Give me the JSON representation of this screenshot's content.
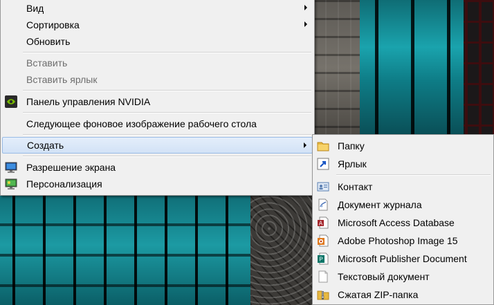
{
  "main_menu": {
    "items": [
      {
        "label": "Вид",
        "submenu": true,
        "enabled": true
      },
      {
        "label": "Сортировка",
        "submenu": true,
        "enabled": true
      },
      {
        "label": "Обновить",
        "enabled": true
      },
      {
        "label": "Вставить",
        "enabled": false
      },
      {
        "label": "Вставить ярлык",
        "enabled": false
      },
      {
        "label": "Панель управления NVIDIA",
        "icon": "nvidia-icon",
        "enabled": true
      },
      {
        "label": "Следующее фоновое изображение рабочего стола",
        "enabled": true
      },
      {
        "label": "Создать",
        "submenu": true,
        "enabled": true,
        "highlighted": true
      },
      {
        "label": "Разрешение экрана",
        "icon": "display-icon",
        "enabled": true
      },
      {
        "label": "Персонализация",
        "icon": "personalization-icon",
        "enabled": true
      }
    ]
  },
  "create_submenu": {
    "items": [
      {
        "label": "Папку",
        "icon": "folder-icon"
      },
      {
        "label": "Ярлык",
        "icon": "shortcut-icon"
      },
      {
        "label": "Контакт",
        "icon": "contact-icon"
      },
      {
        "label": "Документ журнала",
        "icon": "journal-icon"
      },
      {
        "label": "Microsoft Access Database",
        "icon": "access-icon"
      },
      {
        "label": "Adobe Photoshop Image 15",
        "icon": "photoshop-icon"
      },
      {
        "label": "Microsoft Publisher Document",
        "icon": "publisher-icon"
      },
      {
        "label": "Текстовый документ",
        "icon": "text-document-icon"
      },
      {
        "label": "Сжатая ZIP-папка",
        "icon": "zip-folder-icon"
      }
    ]
  }
}
